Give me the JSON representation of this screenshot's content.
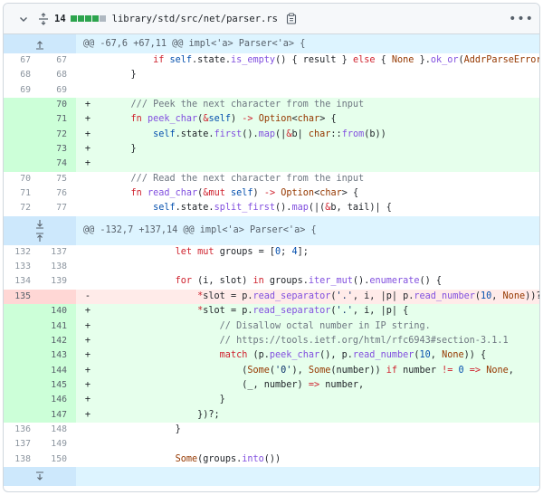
{
  "file": {
    "additions_count": "14",
    "path": "library/std/src/net/parser.rs",
    "diffstat_colors": [
      "#2da44e",
      "#2da44e",
      "#2da44e",
      "#2da44e",
      "#afb8c1"
    ]
  },
  "hunks": [
    {
      "header": "@@ -67,6 +67,11 @@ impl<'a> Parser<'a> {"
    },
    {
      "header": "@@ -132,7 +137,14 @@ impl<'a> Parser<'a> {"
    }
  ],
  "lines": [
    {
      "type": "ctx",
      "old": "67",
      "new": "67",
      "code": "        if self.state.is_empty() { result } else { None }.ok_or(AddrParseError(()))"
    },
    {
      "type": "ctx",
      "old": "68",
      "new": "68",
      "code": "    }"
    },
    {
      "type": "ctx",
      "old": "69",
      "new": "69",
      "code": ""
    },
    {
      "type": "add",
      "old": "",
      "new": "70",
      "code": "    /// Peek the next character from the input"
    },
    {
      "type": "add",
      "old": "",
      "new": "71",
      "code": "    fn peek_char(&self) -> Option<char> {"
    },
    {
      "type": "add",
      "old": "",
      "new": "72",
      "code": "        self.state.first().map(|&b| char::from(b))"
    },
    {
      "type": "add",
      "old": "",
      "new": "73",
      "code": "    }"
    },
    {
      "type": "add",
      "old": "",
      "new": "74",
      "code": ""
    },
    {
      "type": "ctx",
      "old": "70",
      "new": "75",
      "code": "    /// Read the next character from the input"
    },
    {
      "type": "ctx",
      "old": "71",
      "new": "76",
      "code": "    fn read_char(&mut self) -> Option<char> {"
    },
    {
      "type": "ctx",
      "old": "72",
      "new": "77",
      "code": "        self.state.split_first().map(|(&b, tail)| {"
    },
    {
      "type": "ctx",
      "old": "132",
      "new": "137",
      "code": "            let mut groups = [0; 4];"
    },
    {
      "type": "ctx",
      "old": "133",
      "new": "138",
      "code": ""
    },
    {
      "type": "ctx",
      "old": "134",
      "new": "139",
      "code": "            for (i, slot) in groups.iter_mut().enumerate() {"
    },
    {
      "type": "del",
      "old": "135",
      "new": "",
      "code": "                *slot = p.read_separator('.', i, |p| p.read_number(10, None))?;"
    },
    {
      "type": "add",
      "old": "",
      "new": "140",
      "code": "                *slot = p.read_separator('.', i, |p| {"
    },
    {
      "type": "add",
      "old": "",
      "new": "141",
      "code": "                    // Disallow octal number in IP string."
    },
    {
      "type": "add",
      "old": "",
      "new": "142",
      "code": "                    // https://tools.ietf.org/html/rfc6943#section-3.1.1"
    },
    {
      "type": "add",
      "old": "",
      "new": "143",
      "code": "                    match (p.peek_char(), p.read_number(10, None)) {"
    },
    {
      "type": "add",
      "old": "",
      "new": "144",
      "code": "                        (Some('0'), Some(number)) if number != 0 => None,"
    },
    {
      "type": "add",
      "old": "",
      "new": "145",
      "code": "                        (_, number) => number,"
    },
    {
      "type": "add",
      "old": "",
      "new": "146",
      "code": "                    }"
    },
    {
      "type": "add",
      "old": "",
      "new": "147",
      "code": "                })?;"
    },
    {
      "type": "ctx",
      "old": "136",
      "new": "148",
      "code": "            }"
    },
    {
      "type": "ctx",
      "old": "137",
      "new": "149",
      "code": ""
    },
    {
      "type": "ctx",
      "old": "138",
      "new": "150",
      "code": "            Some(groups.into())"
    }
  ]
}
